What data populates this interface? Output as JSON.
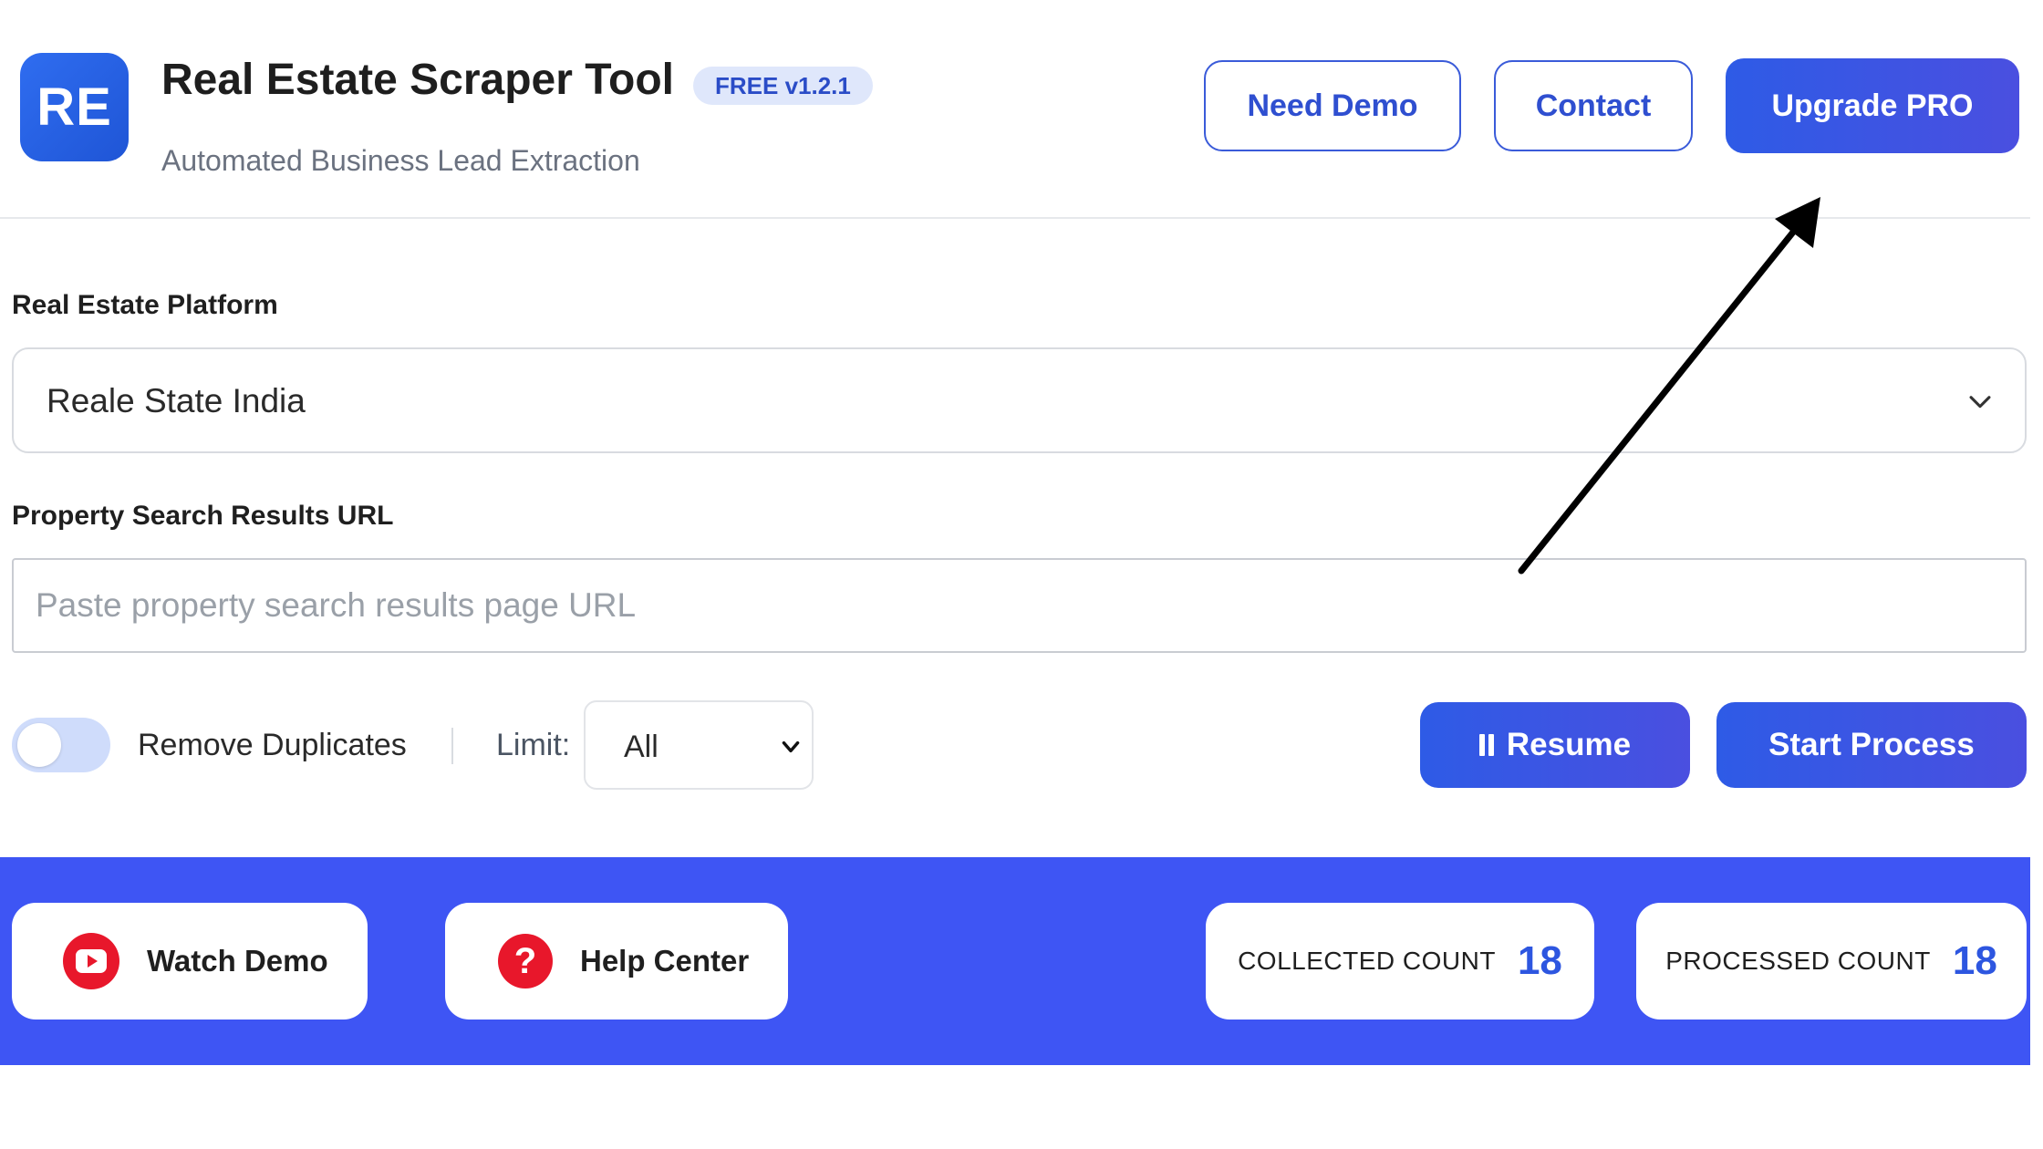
{
  "header": {
    "logo_text": "RE",
    "title": "Real Estate Scraper Tool",
    "version_badge": "FREE v1.2.1",
    "subtitle": "Automated Business Lead Extraction",
    "buttons": {
      "need_demo": "Need Demo",
      "contact": "Contact",
      "upgrade": "Upgrade PRO"
    }
  },
  "form": {
    "platform": {
      "label": "Real Estate Platform",
      "selected": "Reale State India"
    },
    "url": {
      "label": "Property Search Results URL",
      "value": "",
      "placeholder": "Paste property search results page URL"
    }
  },
  "controls": {
    "remove_duplicates": {
      "label": "Remove Duplicates",
      "enabled": false
    },
    "limit": {
      "label": "Limit:",
      "selected": "All"
    },
    "resume_label": "Resume",
    "start_label": "Start Process"
  },
  "footer": {
    "watch_demo": "Watch Demo",
    "help_center": "Help Center",
    "help_icon_glyph": "?",
    "collected": {
      "label": "COLLECTED COUNT",
      "value": "18"
    },
    "processed": {
      "label": "PROCESSED COUNT",
      "value": "18"
    }
  },
  "colors": {
    "accent": "#3e55f4",
    "primary_button": "#2e5be6",
    "badge_bg": "#dfe7fb",
    "icon_red": "#e8172b"
  },
  "icons": {
    "chevron": "chevron-down-icon",
    "pause": "pause-icon",
    "youtube": "youtube-icon",
    "help": "question-icon",
    "annotation": "arrow-annotation"
  }
}
